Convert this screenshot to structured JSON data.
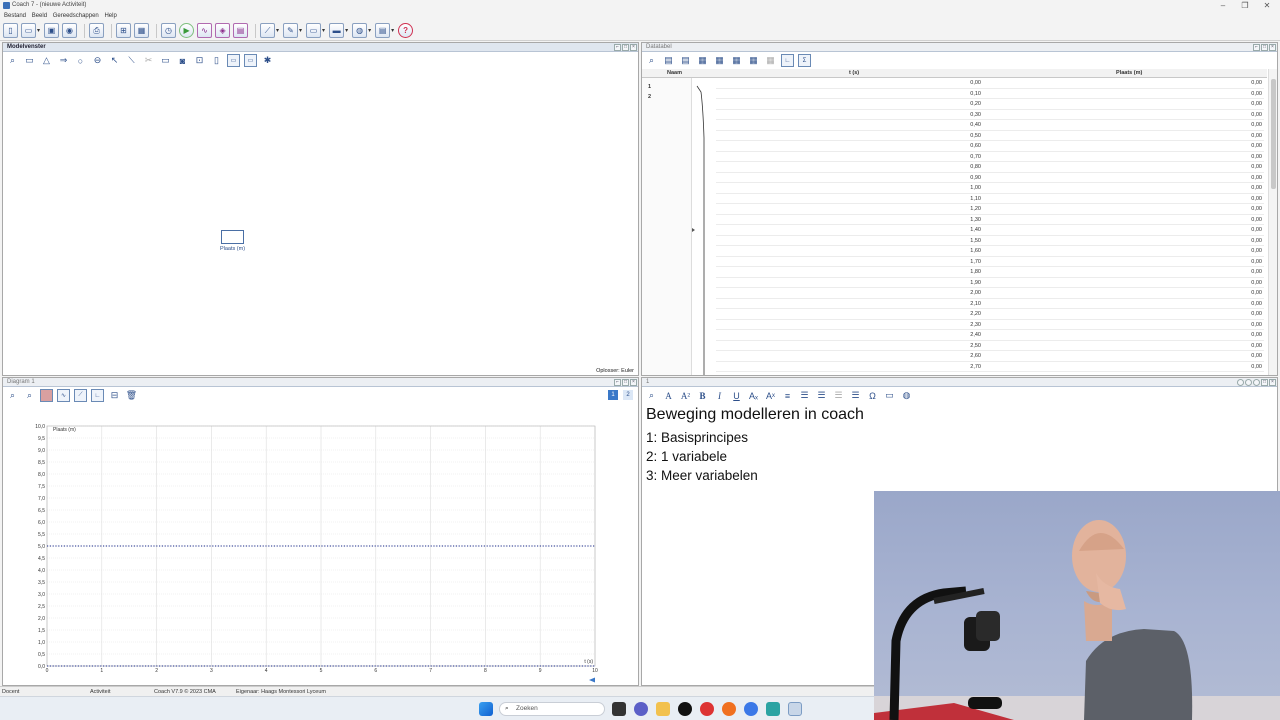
{
  "window": {
    "title": "Coach 7 - (nieuwe Activiteit)"
  },
  "menu": [
    "Bestand",
    "Beeld",
    "Gereedschappen",
    "Help"
  ],
  "panels": {
    "model": {
      "title": "Modelvenster",
      "node_label": "Plaats (m)",
      "solver": "Oplosser: Euler"
    },
    "datatable": {
      "title": "Datatabel",
      "columns": [
        "Naam",
        "t (s)",
        "Plaats (m)"
      ],
      "row_numbers": [
        "1",
        "2"
      ],
      "t_values": [
        "0,00",
        "0,10",
        "0,20",
        "0,30",
        "0,40",
        "0,50",
        "0,60",
        "0,70",
        "0,80",
        "0,90",
        "1,00",
        "1,10",
        "1,20",
        "1,30",
        "1,40",
        "1,50",
        "1,60",
        "1,70",
        "1,80",
        "1,90",
        "2,00",
        "2,10",
        "2,20",
        "2,30",
        "2,40",
        "2,50",
        "2,60",
        "2,70"
      ],
      "plaats_values": [
        "0,00",
        "0,00",
        "0,00",
        "0,00",
        "0,00",
        "0,00",
        "0,00",
        "0,00",
        "0,00",
        "0,00",
        "0,00",
        "0,00",
        "0,00",
        "0,00",
        "0,00",
        "0,00",
        "0,00",
        "0,00",
        "0,00",
        "0,00",
        "0,00",
        "0,00",
        "0,00",
        "0,00",
        "0,00",
        "0,00",
        "0,00",
        "0,00"
      ]
    },
    "diagram": {
      "title": "Diagram 1",
      "page_buttons": [
        "1",
        "2"
      ]
    },
    "text": {
      "title": "1",
      "heading": "Beweging modelleren in coach",
      "lines": [
        "1: Basisprincipes",
        "2: 1 variabele",
        "3: Meer variabelen"
      ]
    }
  },
  "chart_data": {
    "type": "line",
    "ylabel": "Plaats (m)",
    "x_unit_label": "t (s)",
    "xlim": [
      0,
      10
    ],
    "ylim": [
      0,
      10
    ],
    "x_ticks": [
      "0",
      "1",
      "2",
      "3",
      "4",
      "5",
      "6",
      "7",
      "8",
      "9",
      "10"
    ],
    "y_ticks": [
      "0,0",
      "0,5",
      "1,0",
      "1,5",
      "2,0",
      "2,5",
      "3,0",
      "3,5",
      "4,0",
      "4,5",
      "5,0",
      "5,5",
      "6,0",
      "6,5",
      "7,0",
      "7,5",
      "8,0",
      "8,5",
      "9,0",
      "9,5",
      "10,0"
    ],
    "series": [
      {
        "x": [
          0,
          10
        ],
        "values": [
          5,
          5
        ],
        "style": "dotted",
        "color": "#1a2a8a"
      },
      {
        "x": [
          0,
          10
        ],
        "values": [
          0,
          0
        ],
        "style": "dotted",
        "color": "#1a2a8a"
      }
    ],
    "grid": true
  },
  "statusbar": [
    "Docent",
    "Activiteit",
    "Coach V7.9 © 2023 CMA",
    "Eigenaar: Haags Montessori Lyceum"
  ],
  "taskbar": {
    "search_placeholder": "Zoeken"
  },
  "colors": {
    "accent": "#2d4f8a",
    "panel_header": "#dfe6ef",
    "help": "#d03050"
  }
}
